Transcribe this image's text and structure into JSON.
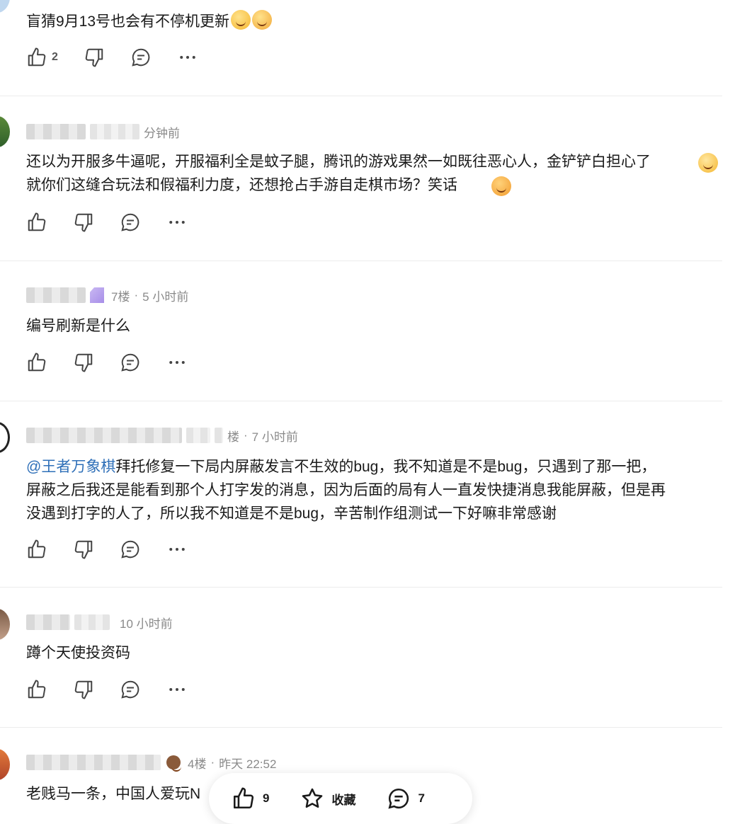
{
  "comments": [
    {
      "meta": "",
      "time": "",
      "text": "盲猜9月13号也会有不停机更新",
      "like_count": "2"
    },
    {
      "time": "分钟前",
      "text": "还以为开服多牛逼呢，开服福利全是蚊子腿，腾讯的游戏果然一如既往恶心人，金铲铲白担心了\n就你们这缝合玩法和假福利力度，还想抢占手游自走棋市场？笑话",
      "like_count": ""
    },
    {
      "floor": "7楼",
      "time": "5 小时前",
      "text": "编号刷新是什么",
      "like_count": ""
    },
    {
      "floor": "楼",
      "time": "7 小时前",
      "mention": "@王者万象棋",
      "text": "拜托修复一下局内屏蔽发言不生效的bug，我不知道是不是bug，只遇到了那一把，\n屏蔽之后我还是能看到那个人打字发的消息，因为后面的局有人一直发快捷消息我能屏蔽，但是再\n没遇到打字的人了，所以我不知道是不是bug，辛苦制作组测试一下好嘛非常感谢",
      "like_count": ""
    },
    {
      "time": "10 小时前",
      "text": "蹲个天使投资码",
      "like_count": ""
    },
    {
      "floor": "4楼",
      "time": "昨天 22:52",
      "text": "老贱马一条，中国人爱玩N",
      "like_count": ""
    }
  ],
  "separator": "·",
  "bottom_bar": {
    "like_count": "9",
    "favorite_label": "收藏",
    "comment_count": "7"
  },
  "icons": {
    "like": "thumbs-up-icon",
    "dislike": "thumbs-down-icon",
    "reply": "comment-icon",
    "more": "more-icon",
    "favorite": "star-icon"
  }
}
